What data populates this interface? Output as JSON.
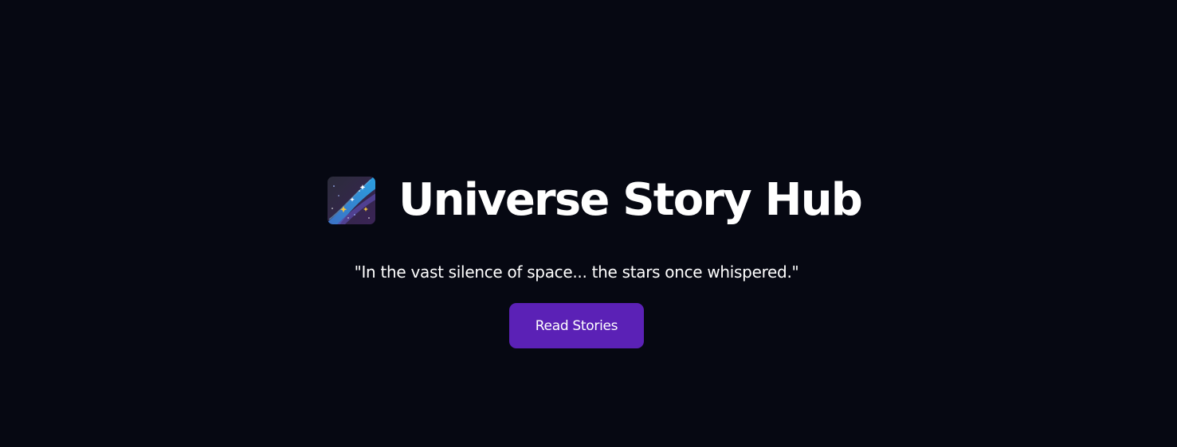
{
  "hero": {
    "logo_icon": "milky-way-icon",
    "title": "Universe Story Hub",
    "quote": "\"In the vast silence of space... the stars once whispered.\"",
    "cta_label": "Read Stories"
  },
  "colors": {
    "background": "#060812",
    "text": "#ffffff",
    "accent": "#5b21b6"
  }
}
